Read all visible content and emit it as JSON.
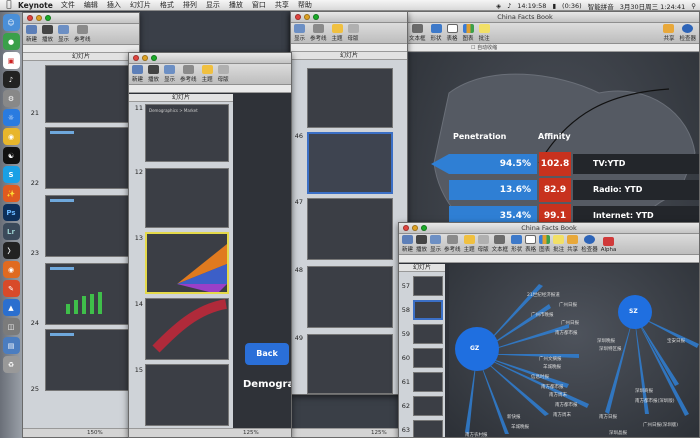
{
  "menubar": {
    "app_name": "Keynote",
    "menus": [
      "文件",
      "编辑",
      "插入",
      "幻灯片",
      "格式",
      "排列",
      "显示",
      "播放",
      "窗口",
      "共享",
      "帮助"
    ],
    "clock_time": "14:19:58",
    "battery": "(0:36)",
    "input_method": "智能拼音",
    "date_time": "3月30日周三 1:24:41"
  },
  "window_main": {
    "title": "China Facts Book"
  },
  "window_front": {
    "title": "China Facts Book"
  },
  "toolbar": {
    "new": "新建",
    "play": "播放",
    "view": "显示",
    "guides": "参考线",
    "themes": "主题",
    "masters": "母版",
    "textbox": "文本框",
    "shapes": "形状",
    "table": "表格",
    "chart": "图表",
    "comment": "批注",
    "share": "共享",
    "inspector": "检查器",
    "alpha": "Alpha"
  },
  "sidebar_header": "幻灯片",
  "slide_numbers_left": [
    "21",
    "22",
    "23",
    "24",
    "25"
  ],
  "slide_numbers_mid": [
    "11",
    "12",
    "13",
    "14",
    "15"
  ],
  "slide_numbers_win3": [
    "46",
    "47",
    "48",
    "49"
  ],
  "slide_numbers_front": [
    "57",
    "58",
    "59",
    "60",
    "61",
    "62",
    "63"
  ],
  "zoom": {
    "left": "150%",
    "mid": "125%",
    "main": "125%"
  },
  "main_slide": {
    "col_penetration": "Penetration",
    "col_affinity": "Affinity",
    "rows": [
      {
        "penetration": "94.5%",
        "affinity": "102.8",
        "label": "TV:YTD"
      },
      {
        "penetration": "13.6%",
        "affinity": "82.9",
        "label": "Radio: YTD"
      },
      {
        "penetration": "35.4%",
        "affinity": "99.1",
        "label": "Internet: YTD"
      }
    ]
  },
  "back_button": "Back",
  "demogra_text": "Demogra",
  "auto_size": "自动收缩",
  "thumb_heading": "Demographics > Market",
  "front_slide": {
    "nodes": [
      "GZ",
      "SZ"
    ],
    "labels": [
      "21世纪经济报道",
      "广州日报",
      "广州市晚报",
      "广州日报",
      "南方都市报",
      "深圳晚报",
      "深圳特区报",
      "广州文摘报",
      "羊城晚报",
      "信息时报",
      "南方都市报",
      "南方周末",
      "宝安日报",
      "南方都市报(深圳版)",
      "深圳商报",
      "广州日报(深圳版)",
      "南方日报",
      "南方周末",
      "南方都市报",
      "深圳晶报",
      "新快报",
      "羊城晚报",
      "南方农村报"
    ]
  },
  "colors": {
    "accent_blue": "#2f7fd4",
    "affinity_red": "#c8321e",
    "node_blue": "#1f6fe0",
    "back_button_blue": "#2a6fd8"
  }
}
